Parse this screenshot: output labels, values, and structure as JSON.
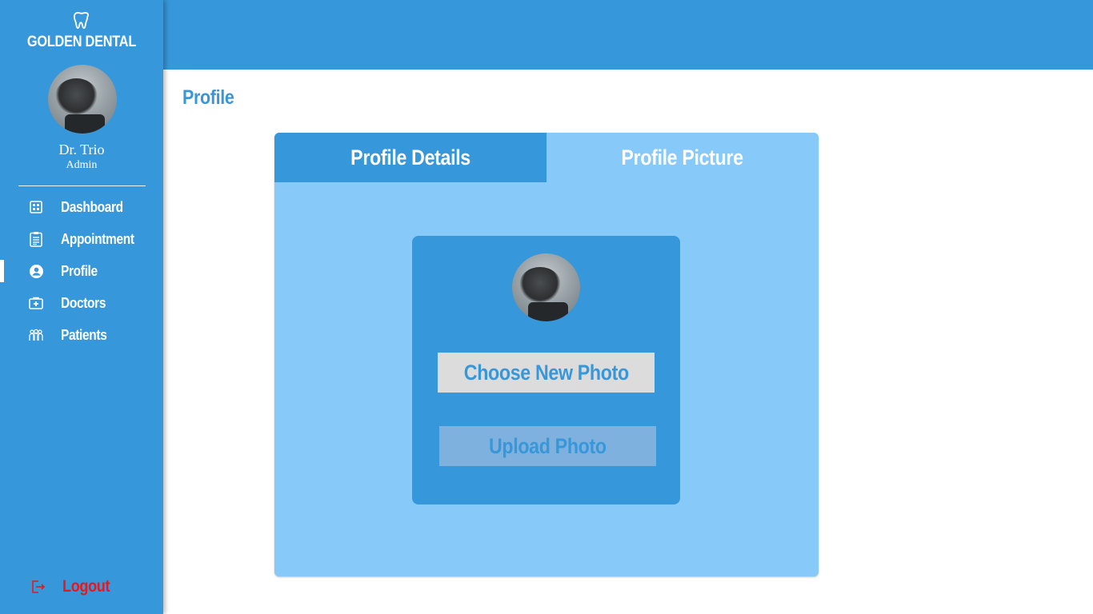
{
  "brand": {
    "name": "GOLDEN DENTAL",
    "icon": "tooth-icon"
  },
  "user": {
    "name": "Dr. Trio",
    "role": "Admin"
  },
  "nav": {
    "items": [
      {
        "label": "Dashboard",
        "icon": "dashboard-grid-icon"
      },
      {
        "label": "Appointment",
        "icon": "clipboard-icon"
      },
      {
        "label": "Profile",
        "icon": "user-circle-icon",
        "active": true
      },
      {
        "label": "Doctors",
        "icon": "medical-kit-icon"
      },
      {
        "label": "Patients",
        "icon": "patients-group-icon"
      }
    ],
    "logout": {
      "label": "Logout",
      "icon": "logout-icon"
    }
  },
  "page": {
    "title": "Profile"
  },
  "tabs": [
    {
      "label": "Profile Details",
      "active": false
    },
    {
      "label": "Profile Picture",
      "active": true
    }
  ],
  "photo_card": {
    "choose_label": "Choose New Photo",
    "upload_label": "Upload Photo"
  },
  "colors": {
    "primary": "#3797db",
    "light": "#87c9f8",
    "logout": "#e8171f",
    "button_bg": "#dcdcdc",
    "upload_bg": "#7fb1de"
  }
}
